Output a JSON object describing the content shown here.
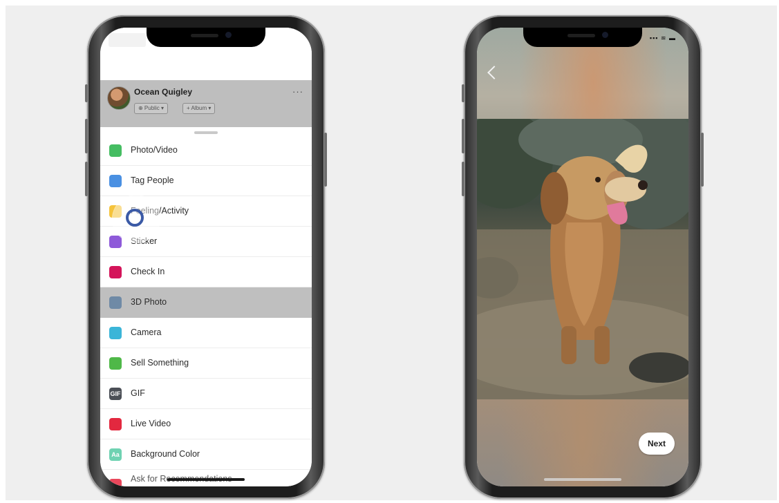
{
  "left_phone": {
    "composer": {
      "author_name": "Ocean Quigley",
      "more_label": "···",
      "privacy_label": "⊕ Public ▾",
      "album_label": "+ Album ▾"
    },
    "menu_items": [
      {
        "label": "Photo/Video",
        "icon": "photo-video-icon",
        "color": "#45bd62"
      },
      {
        "label": "Tag People",
        "icon": "tag-people-icon",
        "color": "#4a90e2"
      },
      {
        "label": "Feeling/Activity",
        "icon": "feeling-activity-icon",
        "color": "#f5c33b"
      },
      {
        "label": "Sticker",
        "icon": "sticker-icon",
        "color": "#8e5ad9"
      },
      {
        "label": "Check In",
        "icon": "check-in-icon",
        "color": "#d4145a"
      },
      {
        "label": "3D Photo",
        "icon": "3d-photo-icon",
        "color": "#6f8aa6",
        "highlighted": true
      },
      {
        "label": "Camera",
        "icon": "camera-icon",
        "color": "#3bb5d8"
      },
      {
        "label": "Sell Something",
        "icon": "sell-something-icon",
        "color": "#4fb848"
      },
      {
        "label": "GIF",
        "icon": "gif-icon",
        "color": "#4b4f56",
        "glyph": "GIF"
      },
      {
        "label": "Live Video",
        "icon": "live-video-icon",
        "color": "#e3283f"
      },
      {
        "label": "Background Color",
        "icon": "background-color-icon",
        "color": "#6fd2b2",
        "glyph": "Aa"
      },
      {
        "label": "Ask for Recommendations",
        "icon": "recommendations-icon",
        "color": "#e9475b"
      }
    ]
  },
  "right_phone": {
    "next_label": "Next",
    "status_label": "▪▪▪ ≋ ▬"
  }
}
